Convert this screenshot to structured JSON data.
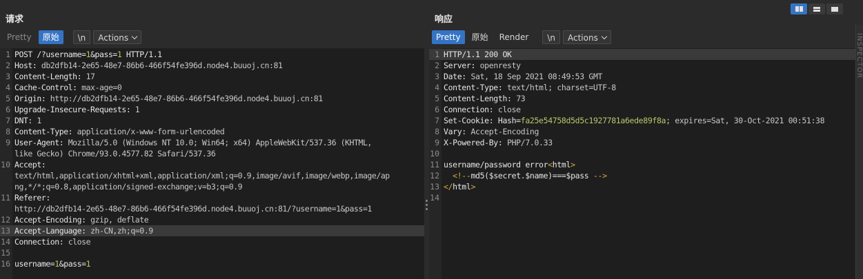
{
  "request": {
    "title": "请求",
    "toolbar": {
      "pretty": "Pretty",
      "raw": "原始",
      "newline": "\\n",
      "actions": "Actions"
    },
    "lines": [
      {
        "n": "1",
        "segs": [
          [
            "k",
            "POST /?username="
          ],
          [
            "g",
            "1"
          ],
          [
            "k",
            "&pass="
          ],
          [
            "g",
            "1"
          ],
          [
            "k",
            " HTTP/1.1"
          ]
        ]
      },
      {
        "n": "2",
        "segs": [
          [
            "k",
            "Host: "
          ],
          [
            "v",
            "db2dfb14-2e65-48e7-86b6-466f54fe396d.node4.buuoj.cn:81"
          ]
        ]
      },
      {
        "n": "3",
        "segs": [
          [
            "k",
            "Content-Length: "
          ],
          [
            "v",
            "17"
          ]
        ]
      },
      {
        "n": "4",
        "segs": [
          [
            "k",
            "Cache-Control: "
          ],
          [
            "v",
            "max-age=0"
          ]
        ]
      },
      {
        "n": "5",
        "segs": [
          [
            "k",
            "Origin: "
          ],
          [
            "v",
            "http://db2dfb14-2e65-48e7-86b6-466f54fe396d.node4.buuoj.cn:81"
          ]
        ]
      },
      {
        "n": "6",
        "segs": [
          [
            "k",
            "Upgrade-Insecure-Requests: "
          ],
          [
            "v",
            "1"
          ]
        ]
      },
      {
        "n": "7",
        "segs": [
          [
            "k",
            "DNT: "
          ],
          [
            "v",
            "1"
          ]
        ]
      },
      {
        "n": "8",
        "segs": [
          [
            "k",
            "Content-Type: "
          ],
          [
            "v",
            "application/x-www-form-urlencoded"
          ]
        ]
      },
      {
        "n": "9",
        "segs": [
          [
            "k",
            "User-Agent: "
          ],
          [
            "v",
            "Mozilla/5.0 (Windows NT 10.0; Win64; x64) AppleWebKit/537.36 (KHTML,"
          ]
        ]
      },
      {
        "n": "",
        "segs": [
          [
            "v",
            "like Gecko) Chrome/93.0.4577.82 Safari/537.36"
          ]
        ]
      },
      {
        "n": "10",
        "segs": [
          [
            "k",
            "Accept:"
          ]
        ]
      },
      {
        "n": "",
        "segs": [
          [
            "v",
            "text/html,application/xhtml+xml,application/xml;q=0.9,image/avif,image/webp,image/ap"
          ]
        ]
      },
      {
        "n": "",
        "segs": [
          [
            "v",
            "ng,*/*;q=0.8,application/signed-exchange;v=b3;q=0.9"
          ]
        ]
      },
      {
        "n": "11",
        "segs": [
          [
            "k",
            "Referer:"
          ]
        ]
      },
      {
        "n": "",
        "segs": [
          [
            "v",
            "http://db2dfb14-2e65-48e7-86b6-466f54fe396d.node4.buuoj.cn:81/?username=1&pass=1"
          ]
        ]
      },
      {
        "n": "12",
        "segs": [
          [
            "k",
            "Accept-Encoding: "
          ],
          [
            "v",
            "gzip, deflate"
          ]
        ]
      },
      {
        "n": "13",
        "hl": true,
        "segs": [
          [
            "k",
            "Accept-Language: "
          ],
          [
            "v",
            "zh-CN,zh;q=0.9"
          ]
        ]
      },
      {
        "n": "14",
        "segs": [
          [
            "k",
            "Connection: "
          ],
          [
            "v",
            "close"
          ]
        ]
      },
      {
        "n": "15",
        "segs": []
      },
      {
        "n": "16",
        "segs": [
          [
            "k",
            "username="
          ],
          [
            "g",
            "1"
          ],
          [
            "k",
            "&pass="
          ],
          [
            "g",
            "1"
          ]
        ]
      }
    ]
  },
  "response": {
    "title": "响应",
    "toolbar": {
      "pretty": "Pretty",
      "raw": "原始",
      "render": "Render",
      "newline": "\\n",
      "actions": "Actions"
    },
    "lines": [
      {
        "n": "1",
        "hl": true,
        "segs": [
          [
            "k",
            "HTTP/1.1 200 OK"
          ]
        ]
      },
      {
        "n": "2",
        "segs": [
          [
            "k",
            "Server: "
          ],
          [
            "v",
            "openresty"
          ]
        ]
      },
      {
        "n": "3",
        "segs": [
          [
            "k",
            "Date: "
          ],
          [
            "v",
            "Sat, 18 Sep 2021 08:49:53 GMT"
          ]
        ]
      },
      {
        "n": "4",
        "segs": [
          [
            "k",
            "Content-Type: "
          ],
          [
            "v",
            "text/html; charset=UTF-8"
          ]
        ]
      },
      {
        "n": "5",
        "segs": [
          [
            "k",
            "Content-Length: "
          ],
          [
            "v",
            "73"
          ]
        ]
      },
      {
        "n": "6",
        "segs": [
          [
            "k",
            "Connection: "
          ],
          [
            "v",
            "close"
          ]
        ]
      },
      {
        "n": "7",
        "segs": [
          [
            "k",
            "Set-Cookie: Hash="
          ],
          [
            "g",
            "fa25e54758d5d5c1927781a6ede89f8a"
          ],
          [
            "v",
            "; expires=Sat, 30-Oct-2021 00:51:38"
          ]
        ]
      },
      {
        "n": "8",
        "segs": [
          [
            "k",
            "Vary: "
          ],
          [
            "v",
            "Accept-Encoding"
          ]
        ]
      },
      {
        "n": "9",
        "segs": [
          [
            "k",
            "X-Powered-By: "
          ],
          [
            "v",
            "PHP/7.0.33"
          ]
        ]
      },
      {
        "n": "10",
        "segs": []
      },
      {
        "n": "11",
        "segs": [
          [
            "k",
            "username/password error"
          ],
          [
            "t",
            "<"
          ],
          [
            "k",
            "html"
          ],
          [
            "t",
            ">"
          ]
        ]
      },
      {
        "n": "12",
        "segs": [
          [
            "v",
            "  "
          ],
          [
            "t",
            "<!--"
          ],
          [
            "k",
            "md5($secret.$name)===$pass "
          ],
          [
            "t",
            "-->"
          ]
        ]
      },
      {
        "n": "13",
        "segs": [
          [
            "t",
            "</"
          ],
          [
            "k",
            "html"
          ],
          [
            "t",
            ">"
          ]
        ]
      },
      {
        "n": "14",
        "segs": []
      }
    ]
  },
  "sidebar": {
    "inspector_label": "INSPECTOR"
  }
}
